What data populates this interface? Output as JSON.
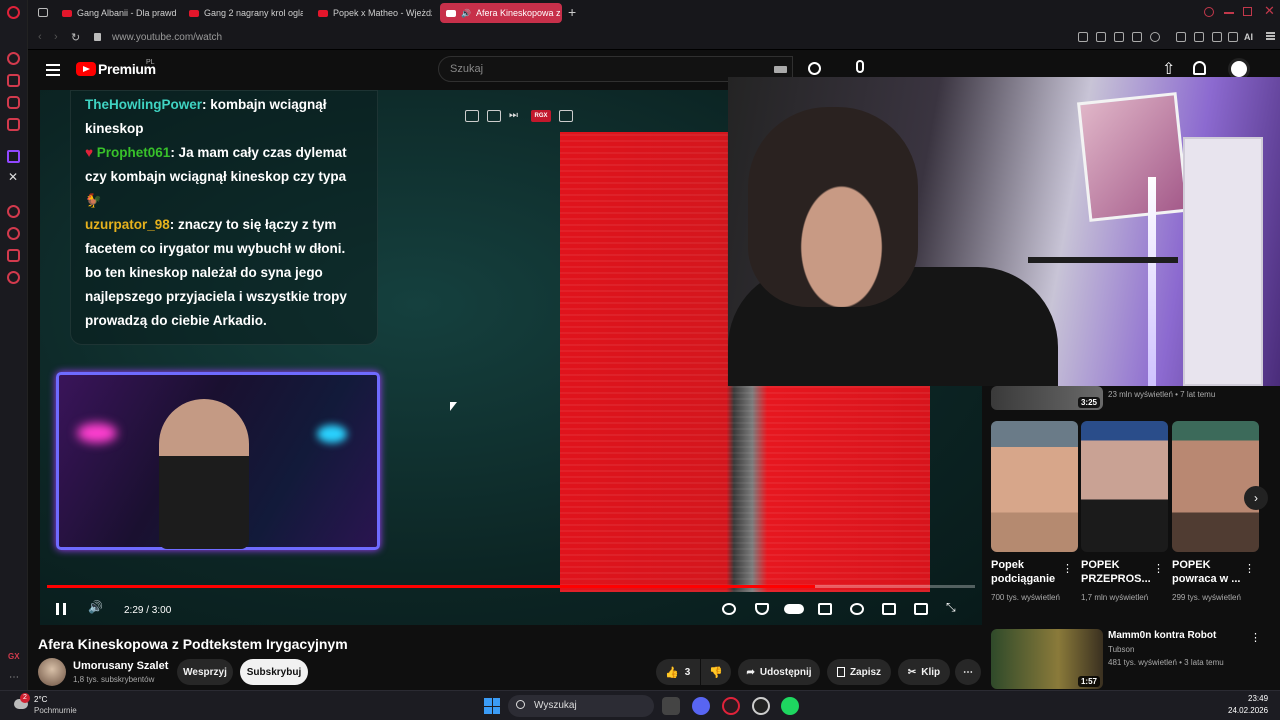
{
  "browser": {
    "tabs": [
      {
        "label": "Gang Albanii - Dla prawdz",
        "active": false
      },
      {
        "label": "Gang 2 nagrany krol oglas",
        "active": false
      },
      {
        "label": "Popek x Matheo - Wjeżdż",
        "active": false
      },
      {
        "label": "Afera Kineskopowa z P",
        "active": true
      }
    ],
    "new_tab": "+",
    "address": "www.youtube.com/watch",
    "ai_label": "AI"
  },
  "header": {
    "logo_text": "Premium",
    "logo_region": "PL",
    "search_placeholder": "Szukaj"
  },
  "video": {
    "chat": [
      {
        "user": "TheHowlingPower",
        "user_color": "#3fd3c2",
        "text": ": kombajn wciągnął kineskop"
      },
      {
        "user": "Prophet061",
        "user_color": "#38c12a",
        "text": ": Ja mam cały czas dylemat czy kombajn wciągnął kineskop czy typa"
      },
      {
        "user": "uzurpator_98",
        "user_color": "#e6b11d",
        "text": ": znaczy to się łączy z tym facetem co irygator mu wybuchł w dłoni. bo ten kineskop należał do syna jego najlepszego przyjaciela i wszystkie tropy prowadzą do ciebie Arkadio."
      }
    ],
    "overlay_badge": "RGX",
    "time_current": "2:29",
    "time_total": "3:00",
    "time_display": "2:29 / 3:00",
    "progress": 0.828
  },
  "below": {
    "title": "Afera Kineskopowa z Podtekstem Irygacyjnym",
    "channel_name": "Umorusany Szalet",
    "channel_subs": "1,8 tys. subskrybentów",
    "support_label": "Wesprzyj",
    "subscribe_label": "Subskrybuj",
    "like_count": "3",
    "share_label": "Udostępnij",
    "save_label": "Zapisz",
    "clip_label": "Klip"
  },
  "sidebar": {
    "top_item": {
      "duration": "3:25",
      "meta": "23 mln wyświetleń • 7 lat temu"
    },
    "shorts": [
      {
        "title": "Popek podciąganie",
        "views": "700 tys. wyświetleń"
      },
      {
        "title": "POPEK PRZEPROS...",
        "views": "1,7 mln wyświetleń"
      },
      {
        "title": "POPEK powraca w ...",
        "views": "299 tys. wyświetleń"
      }
    ],
    "next_item": {
      "title": "Mamm0n kontra Robot",
      "channel": "Tubson",
      "meta": "481 tys. wyświetleń • 3 lata temu",
      "duration": "1:57"
    }
  },
  "taskbar": {
    "weather_temp": "2°C",
    "weather_desc": "Pochmurnie",
    "weather_badge": "2",
    "search_placeholder": "Wyszukaj",
    "time": "23:49",
    "date": "24.02.2026"
  },
  "colors": {
    "accent": "#c7304a",
    "yt_red": "#ff0000"
  }
}
